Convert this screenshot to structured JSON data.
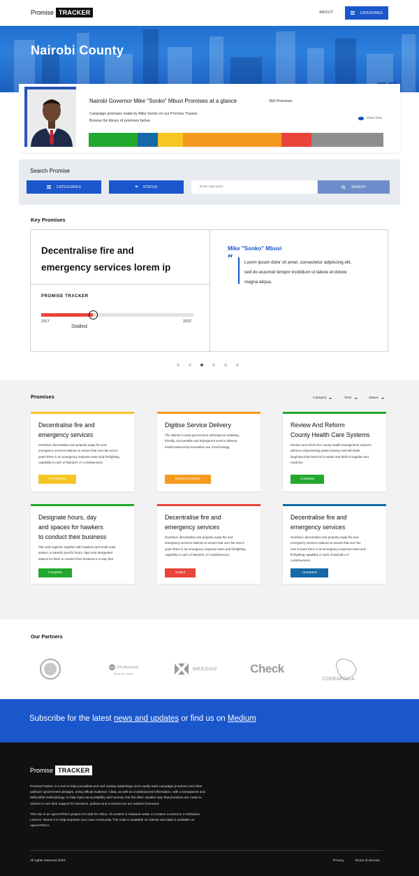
{
  "header": {
    "logo_part1": "Promise",
    "logo_part2": "TRACKER",
    "about_label": "ABOUT",
    "categories_label": "CATEGORIES"
  },
  "hero": {
    "title": "Nairobi County",
    "social": [
      "twitter-icon",
      "facebook-icon"
    ],
    "twitter_glyph": "𝕥",
    "facebook_glyph": "f"
  },
  "governor": {
    "title": "Nairobi Governor Mike \"Sonko\" Mbuvi Promises at a glance",
    "count": "368 Promises",
    "desc_line1": "Campaign promises made by Mike Sonko on our Promise Tracker.",
    "desc_line2": "Browse the library of promises below",
    "chart_view_label": "Chart View",
    "status_distribution": [
      {
        "status": "Complete",
        "fraction": 0.165,
        "color": "#22a82e"
      },
      {
        "status": "Unstarted",
        "fraction": 0.07,
        "color": "#1569a8"
      },
      {
        "status": "In Progress",
        "fraction": 0.085,
        "color": "#f5c624"
      },
      {
        "status": "Behind Schedule",
        "fraction": 0.335,
        "color": "#f59a1e"
      },
      {
        "status": "Stalled",
        "fraction": 0.1,
        "color": "#e9443a"
      },
      {
        "status": "Unknown",
        "fraction": 0.245,
        "color": "#8e8e8e"
      }
    ]
  },
  "search": {
    "title": "Search Promise",
    "categories_label": "CATEGORIES",
    "status_label": "STATUS",
    "keyword_placeholder": "Enter Key word",
    "search_label": "SEARCH"
  },
  "key_promises": {
    "section_title": "Key Promises",
    "title_line1": "Decentralise fire and",
    "title_line2": "emergency services lorem ip",
    "tracker_label": "PROMISE TRACKER",
    "progress": 0.34,
    "start_year": "2017",
    "end_year": "2022",
    "status": "Stalled",
    "quote_author": "Mike \"Sonko\" Mbuvi",
    "quote_mark": "\"",
    "quote_line1": "Lorem ipsum dolor sit amet, consectetur adipiscing elit,",
    "quote_line2": "sed do eiusmod tempor incididunt ut labore et dolore",
    "quote_line3": "magna aliqua.",
    "carousel_pages": 6,
    "carousel_active": 3
  },
  "promises": {
    "section_title": "Promises",
    "filters": [
      "Category",
      "Term",
      "Status"
    ],
    "cards": [
      {
        "title": [
          "Decentralise fire and",
          "emergency services"
        ],
        "desc": [
          "Overhaul, decentralise and properly equip fire and",
          "emergency services stations to ensure that over the next 5",
          "years there is an emergency response team and firefighting",
          "capability in each of Nairobi's 17 constituencies."
        ],
        "status": "In Progress",
        "color": "#f5c624"
      },
      {
        "title": [
          "Digitise Service Delivery"
        ],
        "desc": [
          "The Nairobi County government will adopt an enabling,",
          "friendly, accountable and transparent service delivery",
          "model powered by innovative use of technology."
        ],
        "status": "Behind Schedule",
        "color": "#f59a1e"
      },
      {
        "title": [
          "Review And Reform",
          "County Health Care Systems"
        ],
        "desc": [
          "Review and reform the county health management systems",
          "without compromising patient privacy and eliminate",
          "loopholes that have led to waste and theft of supplies and",
          "medicine."
        ],
        "status": "Complete",
        "color": "#22a82e"
      },
      {
        "title": [
          "Designate hours, day",
          "and spaces for hawkers",
          "to conduct their business"
        ],
        "desc": [
          "Plan and organize together with hawkers and small scale",
          "traders, to identify specific hours, days and designated",
          "spaces for them to conduct their business in a way that"
        ],
        "status": "Complete",
        "color": "#22a82e"
      },
      {
        "title": [
          "Decentralise fire and",
          "emergency services"
        ],
        "desc": [
          "Overhaul, decentralise and properly equip fire and",
          "emergency services stations to ensure that over the next 5",
          "years there is an emergency response team and firefighting",
          "capability in each of Nairobi's 17 constituencies."
        ],
        "status": "Stalled",
        "color": "#e9443a"
      },
      {
        "title": [
          "Decentralise fire and",
          "emergency services"
        ],
        "desc": [
          "Overhaul, decentralise and properly equip fire and",
          "emergency services stations to ensure that over the",
          "next 5 years there is an emergency response team and",
          "firefighting capability in each of Nairobi's 17",
          "constituencies."
        ],
        "status": "Unstarted",
        "color": "#1569a8"
      }
    ]
  },
  "partners": {
    "section_title": "Our Partners",
    "logos": [
      {
        "name": "anci-logo",
        "text": "ANCIR"
      },
      {
        "name": "dw-akademie-logo",
        "text": "DW Akademie",
        "sub": "Made for minds."
      },
      {
        "name": "meedan-logo",
        "text": "MEEDAN"
      },
      {
        "name": "check-logo",
        "text": "Check"
      },
      {
        "name": "code-for-africa-logo",
        "text": "CODE FOR AFRICA"
      }
    ]
  },
  "subscribe": {
    "prefix": "Subscribe for the latest ",
    "link1": "news and updates",
    "middle": " or find us on ",
    "link2": "Medium"
  },
  "footer": {
    "logo_part1": "Promise",
    "logo_part2": "TRACKER",
    "para1": [
      "PromiseTracker, is a tool to help journalists and civil society watchdogs more easily track campaign promises and other",
      "political / government pledges, using official evidence / data, as well as crowdsourced information, with a transparent and",
      "defensible methodology, to help inject accountability and honesty into the often cavalier way that promises are made to",
      "citizens to win their support for elections, policies and contracts but are seldom honoured."
    ],
    "para2": [
      "This site is an openAFRICA project of Code for Africa. All content is released under a Creative Commons 4 Attribution",
      "Licence. Reuse it to help empower your own community. The code is available on GitHub and data is available on",
      "openAFRICA."
    ],
    "copyright": "All rights reserved 2020",
    "privacy": "Privacy",
    "terms": "Terms of Service"
  }
}
